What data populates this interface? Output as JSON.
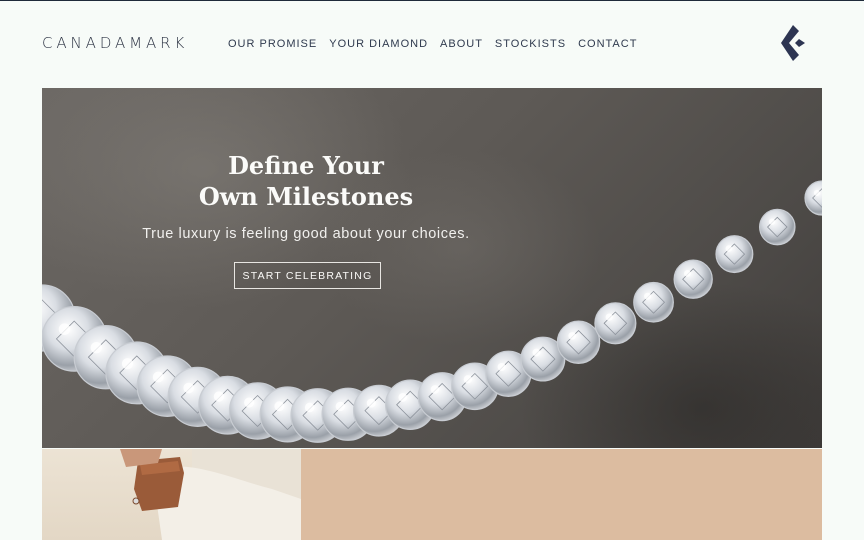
{
  "brand": {
    "logo_text": "CANADAMARK",
    "mark_icon": "chevron-diamond-logo-icon"
  },
  "nav": {
    "items": [
      {
        "label": "OUR PROMISE"
      },
      {
        "label": "YOUR DIAMOND"
      },
      {
        "label": "ABOUT"
      },
      {
        "label": "STOCKISTS"
      },
      {
        "label": "CONTACT"
      }
    ]
  },
  "hero": {
    "title_line1": "Define Your",
    "title_line2": "Own Milestones",
    "subtitle": "True luxury is feeling good about your choices.",
    "cta_label": "START CELEBRATING",
    "image": "diamond-tennis-necklace-on-stone"
  },
  "panels": {
    "left_image": "hand-holding-leather-clutch-with-ring",
    "right_color": "#dcbca0"
  },
  "colors": {
    "background": "#f7fbf8",
    "nav_text": "#2f3a4e",
    "brand_mark": "#2d3552",
    "hero_text": "#fbfbf9"
  }
}
